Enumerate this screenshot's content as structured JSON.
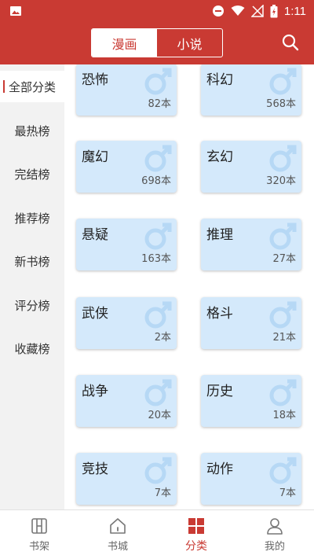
{
  "status_bar": {
    "time": "1:11"
  },
  "header": {
    "tabs": [
      {
        "label": "漫画",
        "active": true
      },
      {
        "label": "小说",
        "active": false
      }
    ]
  },
  "sidebar": {
    "items": [
      {
        "label": "全部分类",
        "active": true
      },
      {
        "label": "最热榜",
        "active": false
      },
      {
        "label": "完结榜",
        "active": false
      },
      {
        "label": "推荐榜",
        "active": false
      },
      {
        "label": "新书榜",
        "active": false
      },
      {
        "label": "评分榜",
        "active": false
      },
      {
        "label": "收藏榜",
        "active": false
      }
    ]
  },
  "categories": [
    {
      "name": "恐怖",
      "count": "82本"
    },
    {
      "name": "科幻",
      "count": "568本"
    },
    {
      "name": "魔幻",
      "count": "698本"
    },
    {
      "name": "玄幻",
      "count": "320本"
    },
    {
      "name": "悬疑",
      "count": "163本"
    },
    {
      "name": "推理",
      "count": "27本"
    },
    {
      "name": "武侠",
      "count": "2本"
    },
    {
      "name": "格斗",
      "count": "21本"
    },
    {
      "name": "战争",
      "count": "20本"
    },
    {
      "name": "历史",
      "count": "18本"
    },
    {
      "name": "竞技",
      "count": "7本"
    },
    {
      "name": "动作",
      "count": "7本"
    }
  ],
  "bottom_nav": [
    {
      "label": "书架",
      "icon": "bookshelf-icon",
      "active": false
    },
    {
      "label": "书城",
      "icon": "home-icon",
      "active": false
    },
    {
      "label": "分类",
      "icon": "category-icon",
      "active": true
    },
    {
      "label": "我的",
      "icon": "profile-icon",
      "active": false
    }
  ],
  "colors": {
    "brand": "#c93a33",
    "card_bg": "#d4e9fb",
    "sidebar_bg": "#f2f2f2"
  }
}
